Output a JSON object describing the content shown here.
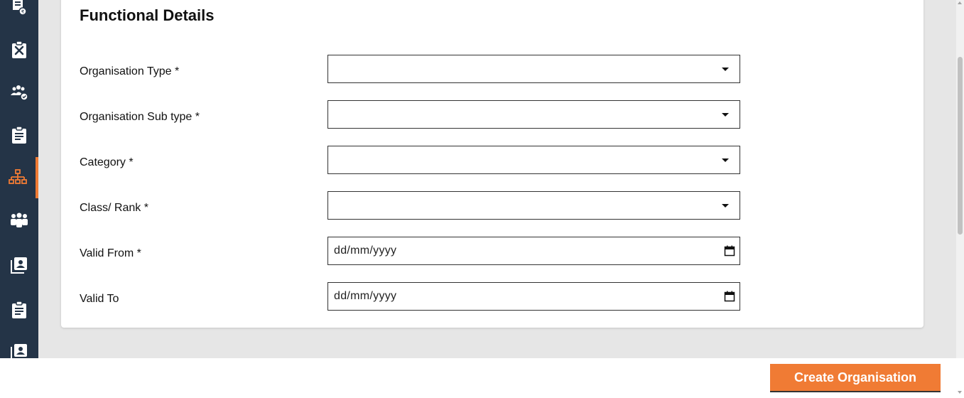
{
  "sidebar": {
    "items": [
      {
        "icon": "invoice-icon",
        "active": false
      },
      {
        "icon": "tools-clipboard-icon",
        "active": false
      },
      {
        "icon": "team-settings-icon",
        "active": false
      },
      {
        "icon": "clipboard-icon",
        "active": false
      },
      {
        "icon": "org-chart-icon",
        "active": true
      },
      {
        "icon": "group-icon",
        "active": false
      },
      {
        "icon": "contact-book-icon",
        "active": false
      },
      {
        "icon": "assignment-icon",
        "active": false
      },
      {
        "icon": "contact-book-icon",
        "active": false
      }
    ]
  },
  "section": {
    "title": "Functional Details"
  },
  "form": {
    "organisation_type": {
      "label": "Organisation Type *",
      "value": ""
    },
    "organisation_sub_type": {
      "label": "Organisation Sub type *",
      "value": ""
    },
    "category": {
      "label": "Category *",
      "value": ""
    },
    "class_rank": {
      "label": "Class/ Rank *",
      "value": ""
    },
    "valid_from": {
      "label": "Valid From *",
      "placeholder": "dd/mm/yyyy"
    },
    "valid_to": {
      "label": "Valid To",
      "placeholder": "dd/mm/yyyy"
    }
  },
  "footer": {
    "create_label": "Create Organisation"
  },
  "colors": {
    "sidebar_bg": "#243447",
    "accent": "#f07b34",
    "page_bg": "#e6e6e6"
  }
}
